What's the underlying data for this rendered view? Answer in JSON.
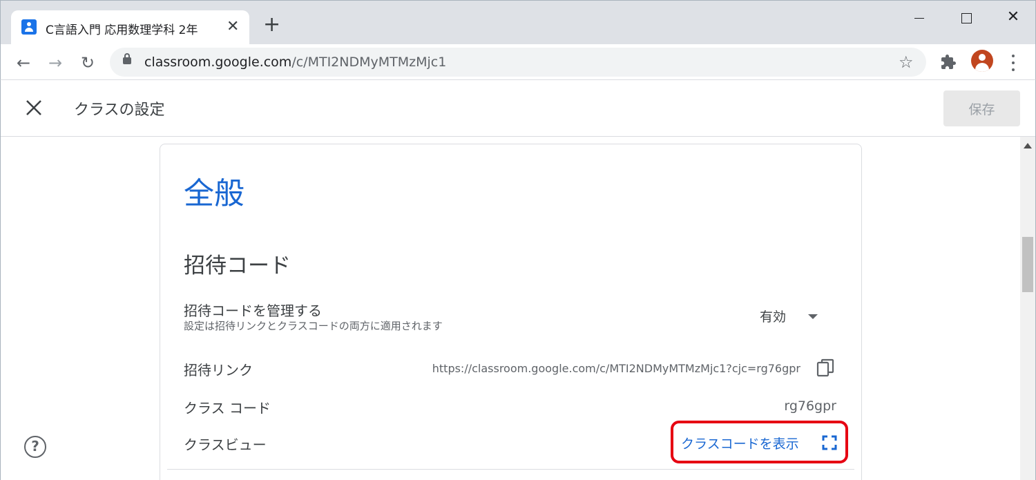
{
  "browser": {
    "tab": {
      "title": "C言語入門 応用数理学科 2年",
      "close_glyph": "✕"
    },
    "new_tab_glyph": "+",
    "window": {
      "close_glyph": "✕"
    },
    "address_bar": {
      "host": "classroom.google.com",
      "path": "/c/MTI2NDMyMTMzMjc1"
    },
    "icons": {
      "back": "←",
      "forward": "→",
      "reload": "↻",
      "bookmark": "☆"
    }
  },
  "appbar": {
    "close_glyph": "close-icon",
    "title": "クラスの設定",
    "save_label": "保存"
  },
  "card": {
    "title": "全般",
    "section_title": "招待コード",
    "manage": {
      "label": "招待コードを管理する",
      "sub": "設定は招待リンクとクラスコードの両方に適用されます",
      "value": "有効"
    },
    "invite_link": {
      "label": "招待リンク",
      "value": "https://classroom.google.com/c/MTI2NDMyMTMzMjc1?cjc=rg76gpr"
    },
    "class_code": {
      "label": "クラス コード",
      "value": "rg76gpr"
    },
    "class_view": {
      "label": "クラスビュー",
      "action": "クラスコードを表示"
    }
  },
  "help_glyph": "?",
  "colors": {
    "accent": "#1967d2",
    "highlight": "#e60012",
    "avatar": "#c1461f"
  }
}
